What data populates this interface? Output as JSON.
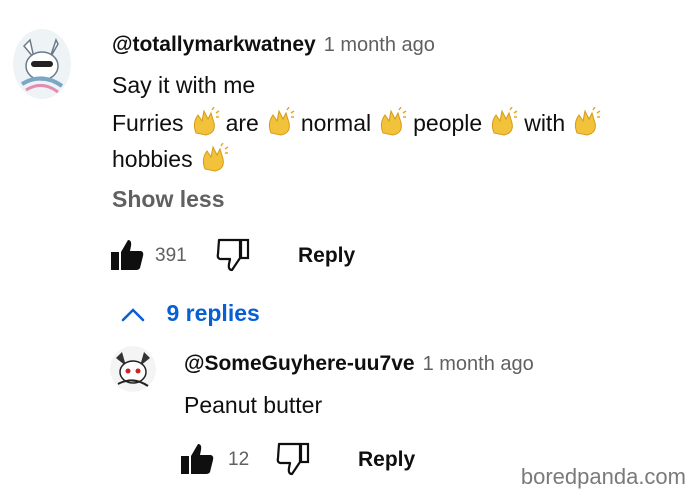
{
  "comment": {
    "handle": "@totallymarkwatney",
    "time": "1 month ago",
    "line1": "Say it with me",
    "words": [
      "Furries",
      "are",
      "normal",
      "people",
      "with"
    ],
    "line3_word": "hobbies",
    "show_less": "Show less",
    "likes": "391",
    "reply_label": "Reply",
    "replies_toggle": "9 replies"
  },
  "reply": {
    "handle": "@SomeGuyhere-uu7ve",
    "time": "1 month ago",
    "text": "Peanut butter",
    "likes": "12",
    "reply_label": "Reply"
  },
  "watermark": "boredpanda.com",
  "colors": {
    "link": "#065fd4",
    "muted": "#606060",
    "clap": "#f2c33a"
  }
}
